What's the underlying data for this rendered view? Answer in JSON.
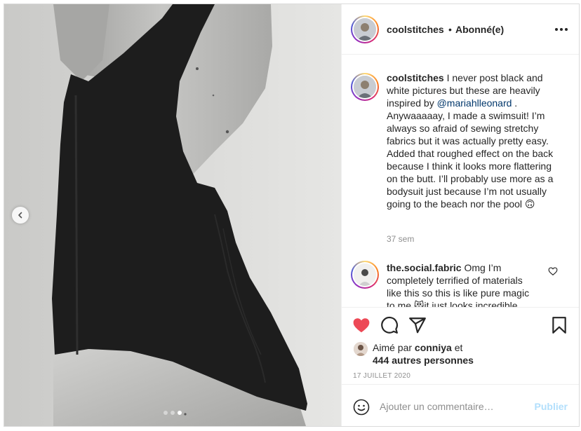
{
  "post": {
    "username": "coolstitches",
    "separator": "•",
    "follow_status": "Abonné(e)",
    "more_icon": "more-horizontal-icon"
  },
  "carousel": {
    "prev_icon": "chevron-left-icon",
    "slides": 3,
    "active_slide": 3
  },
  "caption": {
    "username": "coolstitches",
    "text_before": " I never post black and white pictures but these are heavily inspired by ",
    "mention": "@mariahlleonard",
    "text_after": " . Anywaaaaay, I made a swimsuit! I’m always so afraid of sewing stretchy fabrics but it was actually pretty easy. Added that roughed effect on the back because I think it looks more flattering on the butt. I’ll probably use more as a bodysuit just because I’m not usually going to the beach nor the pool 🙃",
    "time_ago": "37 sem"
  },
  "comment": {
    "username": "the.social.fabric",
    "text": " Omg I’m completely terrified of materials like this so this is like pure magic to me 😻it just looks incredible"
  },
  "actions": {
    "like_icon": "heart-filled-icon",
    "comment_icon": "comment-icon",
    "share_icon": "share-icon",
    "save_icon": "bookmark-icon",
    "like_color": "#ed4956"
  },
  "likes": {
    "prefix": "Aimé par ",
    "user": "conniya",
    "joiner": " et",
    "others": "444 autres personnes"
  },
  "date": "17 JUILLET 2020",
  "add_comment": {
    "emoji_icon": "smiley-icon",
    "placeholder": "Ajouter un commentaire…",
    "publish_label": "Publier",
    "publish_color": "#b2dffc"
  }
}
